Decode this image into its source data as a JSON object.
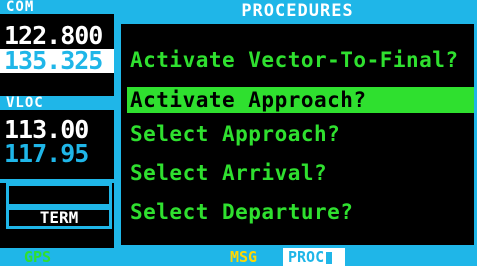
{
  "com": {
    "label": "COM",
    "active": "122.800",
    "standby": "135.325"
  },
  "vloc": {
    "label": "VLOC",
    "active": "113.00",
    "standby": "117.95"
  },
  "cdi_mode": "TERM",
  "procedures": {
    "title": "PROCEDURES",
    "items": [
      "Activate Vector-To-Final?",
      "Activate Approach?",
      "Select Approach?",
      "Select Arrival?",
      "Select Departure?"
    ],
    "selected_index": 1
  },
  "status": {
    "gps": "GPS",
    "msg": "MSG",
    "proc": "PROC"
  },
  "colors": {
    "cyan": "#1fb6e8",
    "green": "#2fe02f",
    "yellow": "#ffd800",
    "white": "#ffffff"
  }
}
